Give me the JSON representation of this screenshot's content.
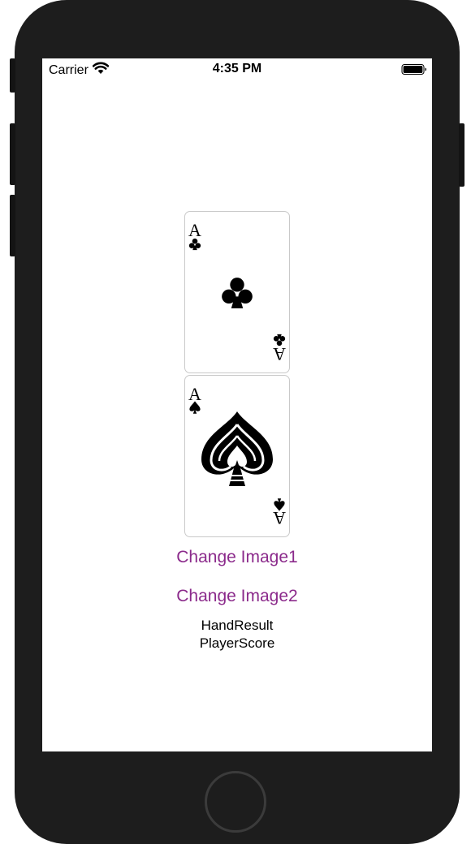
{
  "status_bar": {
    "carrier": "Carrier",
    "time": "4:35 PM",
    "wifi_icon": "wifi-icon",
    "battery_icon": "battery-full-icon"
  },
  "cards": [
    {
      "rank": "A",
      "suit": "clubs",
      "icon": "ace-of-clubs-card"
    },
    {
      "rank": "A",
      "suit": "spades",
      "icon": "ace-of-spades-card"
    }
  ],
  "buttons": {
    "change_image1": "Change Image1",
    "change_image2": "Change Image2"
  },
  "labels": {
    "hand_result": "HandResult",
    "player_score": "PlayerScore"
  },
  "colors": {
    "button_tint": "#8b2a8b",
    "device_bezel": "#1d1d1d"
  }
}
